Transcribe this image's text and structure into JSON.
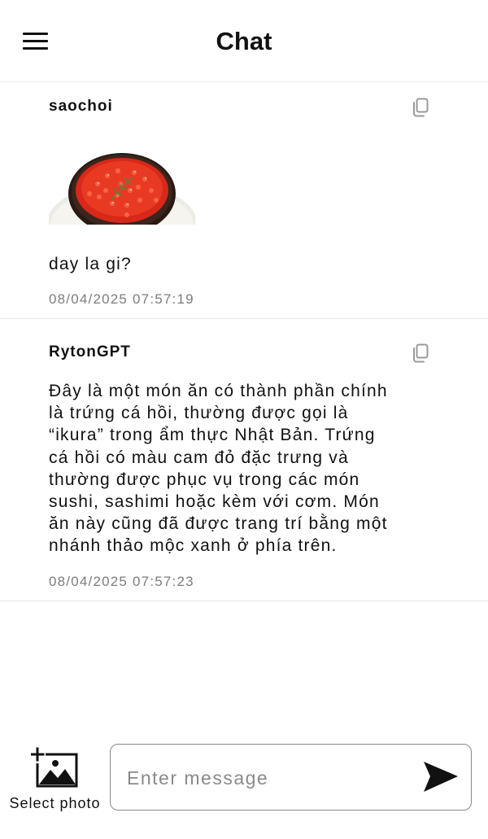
{
  "header": {
    "title": "Chat",
    "menu_icon": "hamburger-menu-icon"
  },
  "messages": [
    {
      "sender": "saochoi",
      "image": "salmon-roe-bowl",
      "text": "day la gi?",
      "timestamp": "08/04/2025 07:57:19",
      "copy_icon": "copy-icon"
    },
    {
      "sender": "RytonGPT",
      "text_lines": [
        "Đây là một món ăn có thành phần chính",
        "là trứng cá hồi, thường được gọi là",
        "“ikura” trong ẩm thực Nhật Bản. Trứng",
        "cá hồi có màu cam đỏ đặc trưng và",
        "thường được phục vụ trong các món",
        "sushi, sashimi hoặc kèm với cơm. Món",
        "ăn này cũng đã được trang trí bằng một",
        "nhánh thảo mộc xanh ở phía trên."
      ],
      "timestamp": "08/04/2025 07:57:23",
      "copy_icon": "copy-icon"
    }
  ],
  "composer": {
    "select_photo_label": "Select photo",
    "select_photo_icon": "add-photo-icon",
    "input_value": "",
    "input_placeholder": "Enter message",
    "send_icon": "send-icon"
  },
  "colors": {
    "text": "#111111",
    "timestamp": "#7d7d7d",
    "divider": "#e6e6e6",
    "icon_gray": "#9a9a9a",
    "input_border": "#8a8a8a"
  }
}
